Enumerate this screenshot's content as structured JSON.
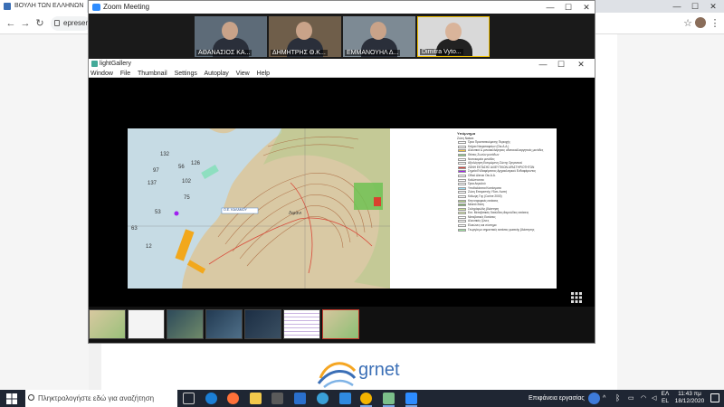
{
  "chrome": {
    "tab_title": "ΒΟΥΛΗ ΤΩΝ ΕΛΛΗΝΩΝ",
    "address_text": "epresen",
    "controls": [
      "—",
      "☐",
      "✕"
    ],
    "new_tab": "+"
  },
  "zoom": {
    "title": "Zoom Meeting",
    "controls": [
      "—",
      "☐",
      "✕"
    ],
    "participants": [
      {
        "name": "ΑΘΑΝΑΣΙΟΣ ΚΑ..."
      },
      {
        "name": "ΔΗΜΗΤΡΗΣ Θ.Κ..."
      },
      {
        "name": "ΕΜΜΑΝΟΥΗΛ Δ..."
      },
      {
        "name": "Dimitra Vyto..."
      }
    ]
  },
  "lightgallery": {
    "title": "lightGallery",
    "controls": [
      "—",
      "☐",
      "✕"
    ],
    "menu": [
      "Window",
      "File",
      "Thumbnail",
      "Settings",
      "Autoplay",
      "View",
      "Help"
    ],
    "map_labels": {
      "place": "Λιμάνι",
      "road_label": "Ο.Ε. ΚΑΛΑΜΟΥ",
      "depths": [
        "132",
        "126",
        "97",
        "102",
        "137",
        "75",
        "53",
        "63",
        "12",
        "56"
      ]
    },
    "legend": {
      "heading": "Υπόμνημα",
      "subheading": "Ζώνη Natura",
      "rows": [
        {
          "label": "Όρια Προστατευόμενης Περιοχής",
          "color": "#ffffff"
        },
        {
          "label": "Κτήρια Νεκροταφείων (Οικ.Α.Α.)",
          "color": "#ffffff"
        },
        {
          "label": "Αλιευτικά & μονοκαλλιέργειες υδατοκαλλιεργητικές μονάδες",
          "color": "#f5c542"
        },
        {
          "label": "Θέσεις Ζωνών μονάδων",
          "color": "#8fd18a"
        },
        {
          "label": "Νοσοκομεία μονάδες",
          "color": "#ffffff"
        },
        {
          "label": "Αξιολόγηση Εκτιμώμενη Ζώνης Οργανικού",
          "color": "#ffffff"
        },
        {
          "label": "ΖΩΝΗ ΕΚΤΑΣΗΣ ΑΛΙΕΥΤΙΚΩΝ ΔΡΑΣΤΗΡΙΟΤΗΤΩΝ",
          "color": "#e0413a"
        },
        {
          "label": "Σημεία Ενδιαφέροντος Αρχαιολογικού Ενδιαφέροντος",
          "color": "#a020f0"
        },
        {
          "label": "Οδικό Δίκτυο Οικ.Α.Α.",
          "color": "#ffffff"
        },
        {
          "label": "Καλύπτονται",
          "color": "#ffffff"
        },
        {
          "label": "Όρια Αιγιαλού",
          "color": "#ffffff"
        },
        {
          "label": "Υποθαλάσσια Κοιτάσματα",
          "color": "#9fe0f5"
        },
        {
          "label": "Ζώνη Επιτρεπτής Υδατ. Λοιπή",
          "color": "#ffffff"
        },
        {
          "label": "Κάλυψη Γης (Corine 2000)",
          "color": "#ffffff"
        },
        {
          "label": "Κτηνοτροφικές εκτάσεις",
          "color": "#b2d188"
        },
        {
          "label": "Μεικτά δάση",
          "color": "#7fb36b"
        },
        {
          "label": "Σκληρόφυλλη βλάστηση",
          "color": "#cfe59b"
        },
        {
          "label": "Εκτ. Μεταβατικές δασώδεις-θαμνώδεις εκτάσεις",
          "color": "#d6e8a8"
        },
        {
          "label": "Μεταβατικές Εκτάσεις",
          "color": "#ffffff"
        },
        {
          "label": "Αλιευτικές ζώνες",
          "color": "#ffffff"
        },
        {
          "label": "Ελαιώνες και σύστημα",
          "color": "#ffffff"
        },
        {
          "label": "Γεωργία με σημαντικές εκτάσεις φυσικής βλάστησης",
          "color": "#9fe6a0"
        }
      ]
    },
    "thumbnails": 7,
    "active_thumbnail": 7
  },
  "taskbar": {
    "search_placeholder": "Πληκτρολογήστε εδώ για αναζήτηση",
    "desktop_label": "Επιφάνεια εργασίας",
    "language": "ΕΛ",
    "language_sub": "EL",
    "time": "11:43 πμ",
    "date": "18/12/2020"
  },
  "page": {
    "logo_text": "grnet"
  }
}
